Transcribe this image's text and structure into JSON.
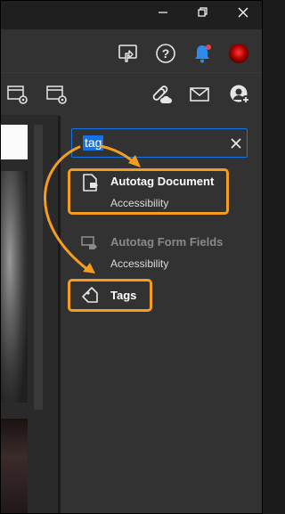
{
  "window_controls": {
    "minimize_icon": "minimize-icon",
    "maximize_icon": "restore-icon",
    "close_icon": "close-icon"
  },
  "header": {
    "icons": [
      "share-screen-icon",
      "help-icon",
      "notification-bell-icon",
      "avatar"
    ],
    "notification_dot_color": "#e34850"
  },
  "toolbar": {
    "icons": [
      "page-settings-icon",
      "page-settings-icon-2",
      "link-cloud-icon",
      "mail-icon",
      "add-user-icon"
    ]
  },
  "search": {
    "value": "tag",
    "clear_icon": "clear-icon"
  },
  "results": [
    {
      "title": "Autotag Document",
      "subtitle": "Accessibility",
      "icon": "document-tag-icon",
      "enabled": true
    },
    {
      "title": "Autotag Form Fields",
      "subtitle": "Accessibility",
      "icon": "form-tag-icon",
      "enabled": false
    },
    {
      "title": "Tags",
      "subtitle": "",
      "icon": "tag-icon",
      "enabled": true
    }
  ],
  "colors": {
    "highlight": "#f59d22",
    "accent": "#1473e6",
    "panel_bg": "#323232"
  }
}
